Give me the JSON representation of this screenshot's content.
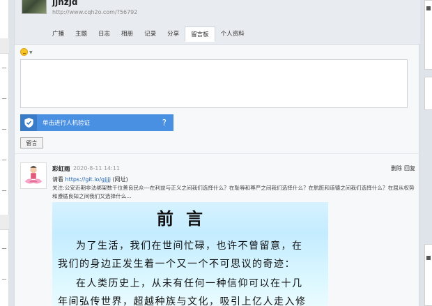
{
  "user": {
    "name": "jjhzjd",
    "url": "http://www.cqh2o.com/?56792"
  },
  "tabs": [
    "广播",
    "主题",
    "日志",
    "相册",
    "记录",
    "分享",
    "留言板",
    "个人资料"
  ],
  "active_tab": "留言板",
  "emoji_caret": "▼",
  "textarea_value": "",
  "captcha": {
    "label": "单击进行人机验证",
    "help": "?"
  },
  "submit_label": "留言",
  "message": {
    "author": "彩虹雨",
    "time": "2020-8-11 14:11",
    "delete_label": "删除",
    "reply_label": "回复",
    "line_prefix": "请看 ",
    "link": "https://git.io/gjjjj",
    "link_suffix": " (网址)",
    "body": "关注:公安近期非法绑架数千位善良民众---在利益与正义之间我们选择什么？在耻辱和尊严之间我们选择什么？在肮脏和道德之间我们选择什么？在屈从权势和遵循良知之间我们又选择什么..."
  },
  "poster": {
    "title": "前言",
    "lines": [
      "为了生活，我们在世间忙碌，也许不曾留意，在",
      "我们的身边正发生着一个又一个不可思议的奇迹：",
      "在人类历史上，从未有任何一种信仰可以在十几",
      "年间弘传世界，超越种族与文化，吸引上亿人走入修"
    ]
  }
}
